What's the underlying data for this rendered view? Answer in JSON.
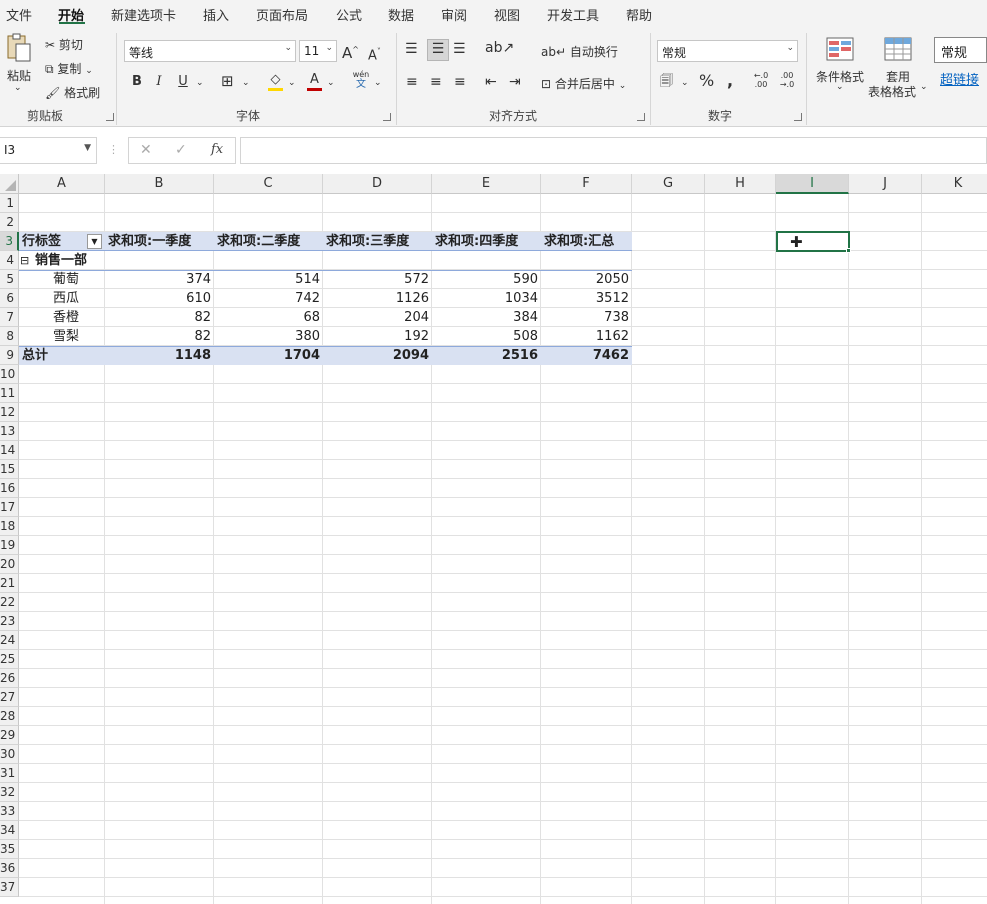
{
  "menu": {
    "tabs": [
      "文件",
      "开始",
      "新建选项卡",
      "插入",
      "页面布局",
      "公式",
      "数据",
      "审阅",
      "视图",
      "开发工具",
      "帮助"
    ],
    "active": "开始"
  },
  "ribbon": {
    "clipboard": {
      "paste": "粘贴",
      "cut": "剪切",
      "copy": "复制",
      "format_painter": "格式刷",
      "label": "剪贴板"
    },
    "font": {
      "name": "等线",
      "size": "11",
      "bold": "B",
      "italic": "I",
      "underline": "U",
      "grow": "A^",
      "shrink": "A˅",
      "label": "字体",
      "wen": "wén",
      "wen2": "文"
    },
    "alignment": {
      "wrap": "自动换行",
      "merge": "合并后居中",
      "label": "对齐方式"
    },
    "number": {
      "format": "常规",
      "percent": "%",
      "comma": ",",
      "dec_inc": "←.0\n.00",
      "dec_dec": ".00\n→.0",
      "label": "数字"
    },
    "styles": {
      "conditional": "条件格式",
      "table1": "套用",
      "table2": "表格格式",
      "style_normal": "常规",
      "style_link": "超链接"
    }
  },
  "formula_bar": {
    "name_box": "I3",
    "cancel": "✕",
    "enter": "✓",
    "fx": "fx",
    "value": ""
  },
  "columns": [
    "A",
    "B",
    "C",
    "D",
    "E",
    "F",
    "G",
    "H",
    "I",
    "J",
    "K"
  ],
  "rows": [
    "1",
    "2",
    "3",
    "4",
    "5",
    "6",
    "7",
    "8",
    "9",
    "10",
    "11",
    "12",
    "13",
    "14",
    "15",
    "16",
    "17",
    "18",
    "19",
    "20",
    "21",
    "22",
    "23",
    "24",
    "25",
    "26",
    "27",
    "28",
    "29",
    "30",
    "31",
    "32",
    "33",
    "34",
    "35",
    "36",
    "37"
  ],
  "selected_cell": "I3",
  "pivot": {
    "row_label_header": "行标签",
    "headers": [
      "求和项:一季度",
      "求和项:二季度",
      "求和项:三季度",
      "求和项:四季度",
      "求和项:汇总"
    ],
    "group": "销售一部",
    "collapse_icon": "⊟",
    "items": [
      {
        "name": "葡萄",
        "values": [
          "374",
          "514",
          "572",
          "590",
          "2050"
        ]
      },
      {
        "name": "西瓜",
        "values": [
          "610",
          "742",
          "1126",
          "1034",
          "3512"
        ]
      },
      {
        "name": "香橙",
        "values": [
          "82",
          "68",
          "204",
          "384",
          "738"
        ]
      },
      {
        "name": "雪梨",
        "values": [
          "82",
          "380",
          "192",
          "508",
          "1162"
        ]
      }
    ],
    "total": {
      "name": "总计",
      "values": [
        "1148",
        "1704",
        "2094",
        "2516",
        "7462"
      ]
    }
  },
  "colors": {
    "accent": "#217346",
    "pivot_header_bg": "#d9e1f2",
    "pivot_total_bg": "#d9e1f2"
  }
}
